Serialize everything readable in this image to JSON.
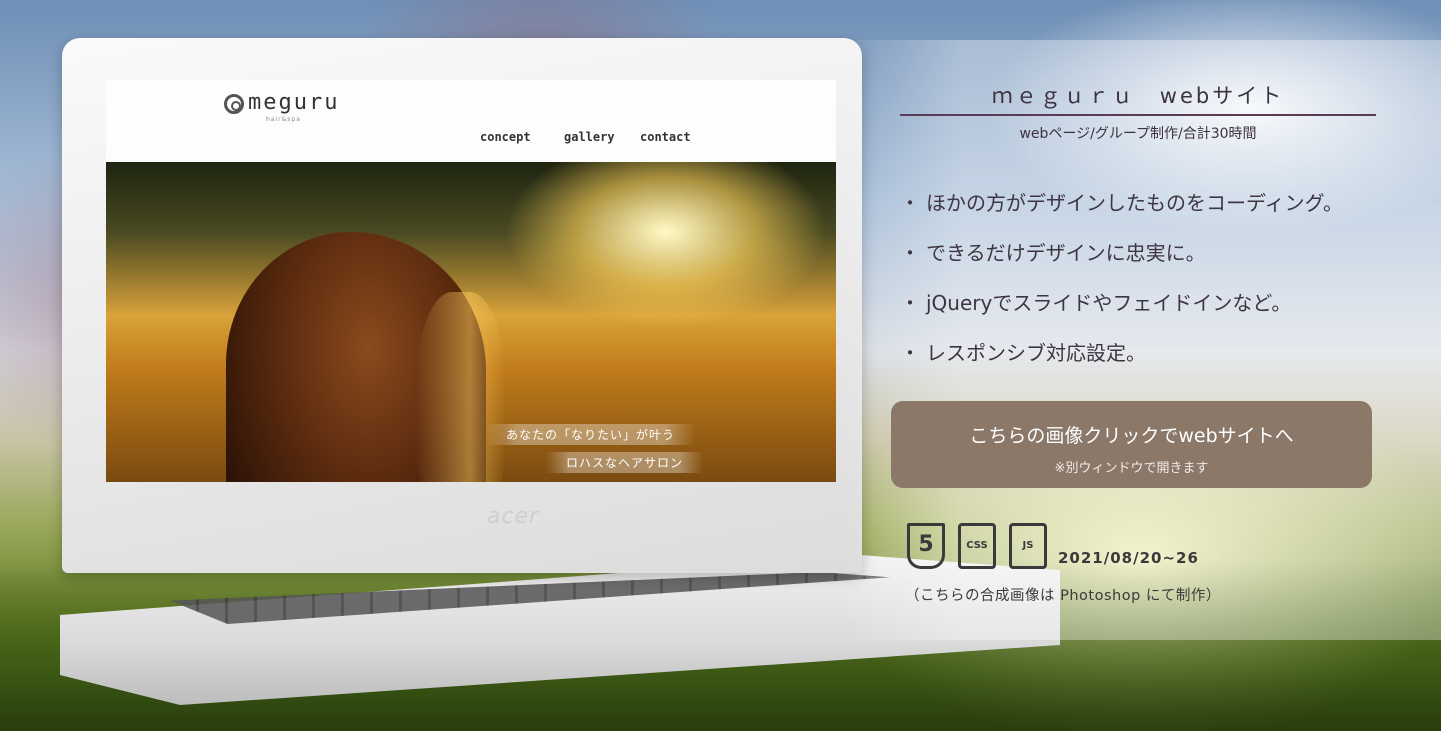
{
  "portfolio": {
    "title": "ｍｅｇｕｒｕ　webサイト",
    "subtitle": "webページ/グループ制作/合計30時間",
    "points": [
      "ほかの方がデザインしたものをコーディング。",
      "できるだけデザインに忠実に。",
      "jQueryでスライドやフェイドインなど。",
      "レスポンシブ対応設定。"
    ],
    "cta": {
      "label": "こちらの画像クリックでwebサイトへ",
      "note": "※別ウィンドウで開きます"
    },
    "tech_icons": [
      {
        "name": "html5-icon",
        "label": "5"
      },
      {
        "name": "css-icon",
        "label": "CSS"
      },
      {
        "name": "js-icon",
        "label": "JS"
      }
    ],
    "date": "2021/08/20~26",
    "credit": "（こちらの合成画像は Photoshop にて制作）"
  },
  "mockup_site": {
    "logo": "meguru",
    "logo_sub": "hair&spa",
    "nav": [
      "concept",
      "gallery",
      "contact"
    ],
    "tagline_1": "あなたの「なりたい」が叶う",
    "tagline_2": "ロハスなヘアサロン"
  },
  "laptop": {
    "brand": "acer"
  },
  "colors": {
    "accent_rule": "#5a3a55",
    "cta_bg": "#8b7869",
    "text": "#3e3542"
  }
}
